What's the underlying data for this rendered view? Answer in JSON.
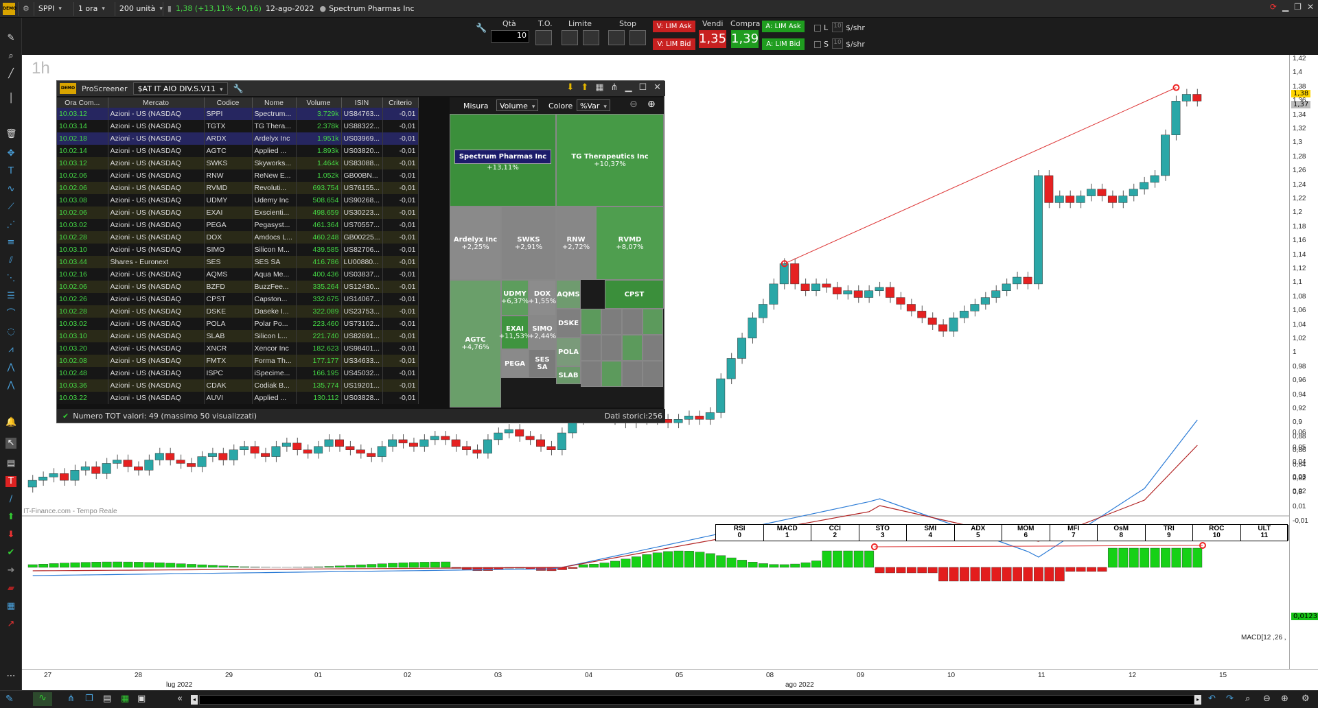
{
  "topbar": {
    "ticker": "SPPI",
    "timeframe": "1 ora",
    "units": "200 unità",
    "price": "1,38 (+13,11% +0,16)",
    "date": "12-ago-2022",
    "company": "Spectrum Pharmas Inc"
  },
  "order": {
    "qta_label": "Qtà",
    "qta_value": "10",
    "to_label": "T.O.",
    "limite_label": "Limite",
    "stop_label": "Stop",
    "v_lim_ask": "V: LIM Ask",
    "v_lim_bid": "V: LIM Bid",
    "vendi_label": "Vendi",
    "compra_label": "Compra",
    "sell_price": "1,35",
    "buy_price": "1,39",
    "a_lim_ask": "A: LIM Ask",
    "a_lim_bid": "A: LIM Bid",
    "l_label": "L",
    "s_label": "S",
    "l_val": "10",
    "s_val": "10",
    "unit1": "$/shr",
    "unit2": "$/shr"
  },
  "chart": {
    "timeframe_label": "1h",
    "watermark": "IT-Finance.com - Tempo Reale",
    "macd_label": "MACD[12 ,26 ,",
    "last_price": "1,38",
    "prev_close": "1,37",
    "macd_value": "0,0123"
  },
  "yaxis": [
    "1,42",
    "1,4",
    "1,38",
    "1,36",
    "1,34",
    "1,32",
    "1,3",
    "1,28",
    "1,26",
    "1,24",
    "1,22",
    "1,2",
    "1,18",
    "1,16",
    "1,14",
    "1,12",
    "1,1",
    "1,08",
    "1,06",
    "1,04",
    "1,02",
    "1",
    "0,98",
    "0,96",
    "0,94",
    "0,92",
    "0,9",
    "0,88",
    "0,86",
    "0,84",
    "0,82",
    "0,8"
  ],
  "yaxis_macd": [
    "0,06",
    "0,05",
    "0,04",
    "0,03",
    "0,02",
    "0,01",
    "-0,01"
  ],
  "xaxis": {
    "days": [
      "27",
      "28",
      "29",
      "01",
      "02",
      "03",
      "04",
      "05",
      "08",
      "09",
      "10",
      "11",
      "12",
      "15"
    ],
    "months": [
      "lug 2022",
      "ago 2022"
    ]
  },
  "indicators": [
    {
      "name": "RSI",
      "n": "0"
    },
    {
      "name": "MACD",
      "n": "1"
    },
    {
      "name": "CCI",
      "n": "2"
    },
    {
      "name": "STO",
      "n": "3"
    },
    {
      "name": "SMI",
      "n": "4"
    },
    {
      "name": "ADX",
      "n": "5"
    },
    {
      "name": "MOM",
      "n": "6"
    },
    {
      "name": "MFI",
      "n": "7"
    },
    {
      "name": "OsM",
      "n": "8"
    },
    {
      "name": "TRI",
      "n": "9"
    },
    {
      "name": "ROC",
      "n": "10"
    },
    {
      "name": "ULT",
      "n": "11"
    }
  ],
  "proscreener": {
    "title": "ProScreener",
    "screen": "$AT IT AIO DIV.S.V11",
    "columns": [
      "Ora Com...",
      "Mercato",
      "Codice",
      "Nome",
      "Volume",
      "ISIN",
      "Criterio"
    ],
    "rows": [
      [
        "10.03.12",
        "Azioni - US (NASDAQ",
        "SPPI",
        "Spectrum...",
        "3.729k",
        "US84763...",
        "-0,01"
      ],
      [
        "10.03.14",
        "Azioni - US (NASDAQ",
        "TGTX",
        "TG Thera...",
        "2.378k",
        "US88322...",
        "-0,01"
      ],
      [
        "10.02.18",
        "Azioni - US (NASDAQ",
        "ARDX",
        "Ardelyx Inc",
        "1.951k",
        "US03969...",
        "-0,01"
      ],
      [
        "10.02.14",
        "Azioni - US (NASDAQ",
        "AGTC",
        "Applied ...",
        "1.893k",
        "US03820...",
        "-0,01"
      ],
      [
        "10.03.12",
        "Azioni - US (NASDAQ",
        "SWKS",
        "Skyworks...",
        "1.464k",
        "US83088...",
        "-0,01"
      ],
      [
        "10.02.06",
        "Azioni - US (NASDAQ",
        "RNW",
        "ReNew E...",
        "1.052k",
        "GB00BN...",
        "-0,01"
      ],
      [
        "10.02.06",
        "Azioni - US (NASDAQ",
        "RVMD",
        "Revoluti...",
        "693.754",
        "US76155...",
        "-0,01"
      ],
      [
        "10.03.08",
        "Azioni - US (NASDAQ",
        "UDMY",
        "Udemy Inc",
        "508.654",
        "US90268...",
        "-0,01"
      ],
      [
        "10.02.06",
        "Azioni - US (NASDAQ",
        "EXAI",
        "Exscienti...",
        "498.659",
        "US30223...",
        "-0,01"
      ],
      [
        "10.03.02",
        "Azioni - US (NASDAQ",
        "PEGA",
        "Pegasyst...",
        "461.364",
        "US70557...",
        "-0,01"
      ],
      [
        "10.02.28",
        "Azioni - US (NASDAQ",
        "DOX",
        "Amdocs L...",
        "460.248",
        "GB00225...",
        "-0,01"
      ],
      [
        "10.03.10",
        "Azioni - US (NASDAQ",
        "SIMO",
        "Silicon M...",
        "439.585",
        "US82706...",
        "-0,01"
      ],
      [
        "10.03.44",
        "Shares - Euronext",
        "SES",
        "SES SA",
        "416.786",
        "LU00880...",
        "-0,01"
      ],
      [
        "10.02.16",
        "Azioni - US (NASDAQ",
        "AQMS",
        "Aqua Me...",
        "400.436",
        "US03837...",
        "-0,01"
      ],
      [
        "10.02.06",
        "Azioni - US (NASDAQ",
        "BZFD",
        "BuzzFee...",
        "335.264",
        "US12430...",
        "-0,01"
      ],
      [
        "10.02.26",
        "Azioni - US (NASDAQ",
        "CPST",
        "Capston...",
        "332.675",
        "US14067...",
        "-0,01"
      ],
      [
        "10.02.28",
        "Azioni - US (NASDAQ",
        "DSKE",
        "Daseke I...",
        "322.089",
        "US23753...",
        "-0,01"
      ],
      [
        "10.03.02",
        "Azioni - US (NASDAQ",
        "POLA",
        "Polar Po...",
        "223.460",
        "US73102...",
        "-0,01"
      ],
      [
        "10.03.10",
        "Azioni - US (NASDAQ",
        "SLAB",
        "Silicon L...",
        "221.740",
        "US82691...",
        "-0,01"
      ],
      [
        "10.03.20",
        "Azioni - US (NASDAQ",
        "XNCR",
        "Xencor Inc",
        "182.623",
        "US98401...",
        "-0,01"
      ],
      [
        "10.02.08",
        "Azioni - US (NASDAQ",
        "FMTX",
        "Forma Th...",
        "177.177",
        "US34633...",
        "-0,01"
      ],
      [
        "10.02.48",
        "Azioni - US (NASDAQ",
        "ISPC",
        "iSpecime...",
        "166.195",
        "US45032...",
        "-0,01"
      ],
      [
        "10.03.36",
        "Azioni - US (NASDAQ",
        "CDAK",
        "Codiak B...",
        "135.774",
        "US19201...",
        "-0,01"
      ],
      [
        "10.03.22",
        "Azioni - US (NASDAQ",
        "AUVI",
        "Applied ...",
        "130.112",
        "US03828...",
        "-0,01"
      ]
    ],
    "misura_label": "Misura",
    "misura_value": "Volume",
    "colore_label": "Colore",
    "colore_value": "%Var",
    "footer_left": "Numero TOT valori: 49 (massimo 50 visualizzati)",
    "footer_right": "Dati storici:256",
    "heat": [
      {
        "name": "Spectrum Pharmas Inc",
        "pct": "+13,11%",
        "color": "#3b8f3b"
      },
      {
        "name": "TG Therapeutics Inc",
        "pct": "+10,37%",
        "color": "#469a46"
      },
      {
        "name": "Ardelyx Inc",
        "pct": "+2,25%",
        "color": "#8a8a8a"
      },
      {
        "name": "SWKS",
        "pct": "+2,91%",
        "color": "#858585"
      },
      {
        "name": "RNW",
        "pct": "+2,72%",
        "color": "#878787"
      },
      {
        "name": "RVMD",
        "pct": "+8,07%",
        "color": "#4f9e4f"
      },
      {
        "name": "UDMY",
        "pct": "+6,37%",
        "color": "#5d9d5d"
      },
      {
        "name": "DOX",
        "pct": "+1,55%",
        "color": "#8c8c8c"
      },
      {
        "name": "AQMS",
        "pct": "",
        "color": "#6f9b6f"
      },
      {
        "name": "CPST",
        "pct": "",
        "color": "#3b8f3b"
      },
      {
        "name": "AGTC",
        "pct": "+4,76%",
        "color": "#6a9f6a"
      },
      {
        "name": "EXAI",
        "pct": "+11,53%",
        "color": "#3f943f"
      },
      {
        "name": "SIMO",
        "pct": "+2,44%",
        "color": "#888"
      },
      {
        "name": "DSKE",
        "pct": "",
        "color": "#7f7f7f"
      },
      {
        "name": "POLA",
        "pct": "",
        "color": "#7a9a7a"
      },
      {
        "name": "PEGA",
        "pct": "",
        "color": "#8a8a8a"
      },
      {
        "name": "SES SA",
        "pct": "",
        "color": "#7b7b7b"
      },
      {
        "name": "SLAB",
        "pct": "",
        "color": "#6a986a"
      }
    ]
  }
}
